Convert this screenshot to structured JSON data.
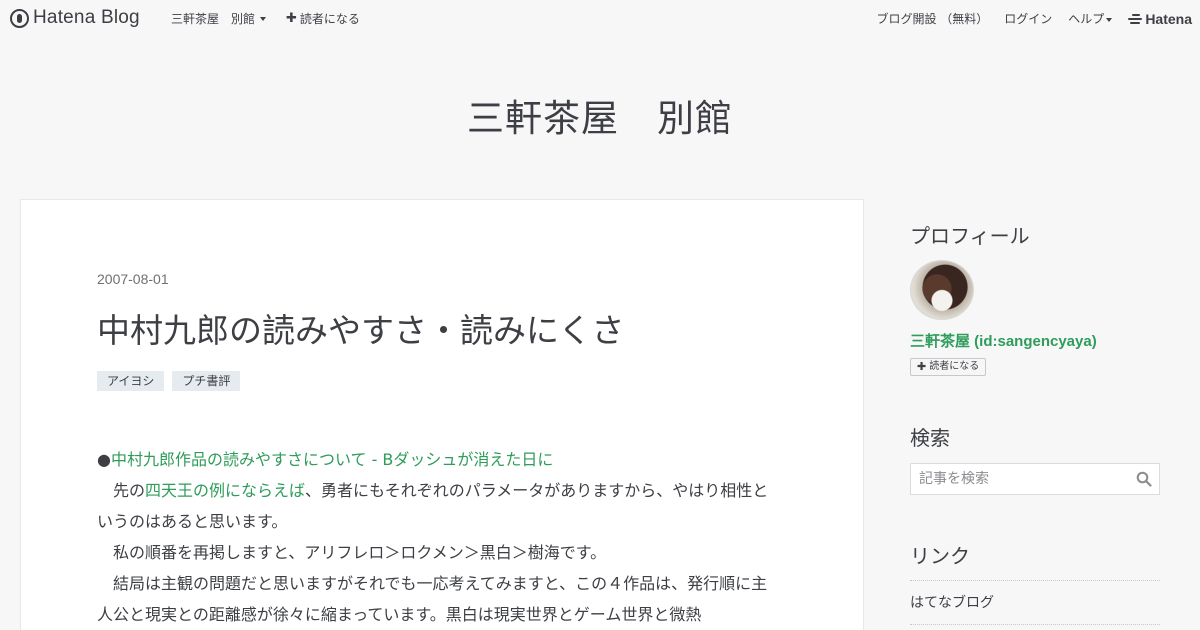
{
  "global_header": {
    "brand": "Hatena Blog",
    "blog_menu": "三軒茶屋　別館",
    "follow": "読者になる",
    "signup": "ブログ開設 （無料）",
    "login": "ログイン",
    "help": "ヘルプ",
    "hatena": "Hatena"
  },
  "blog": {
    "title": "三軒茶屋　別館"
  },
  "entry": {
    "date": "2007-08-01",
    "title": "中村九郎の読みやすさ・読みにくさ",
    "categories": [
      "アイヨシ",
      "プチ書評"
    ],
    "p1_bullet": "●",
    "p1_link": "中村九郎作品の読みやすさについて - Bダッシュが消えた日に",
    "p2_pre": "先の",
    "p2_link": "四天王の例にならえば",
    "p2_post": "、勇者にもそれぞれのパラメータがありますから、やはり相性というのはあると思います。",
    "p3": "私の順番を再掲しますと、アリフレロ＞ロクメン＞黒白＞樹海です。",
    "p4": "結局は主観の問題だと思いますがそれでも一応考えてみますと、この４作品は、発行順に主人公と現実との距離感が徐々に縮まっています。黒白は現実世界とゲーム世界と微熱"
  },
  "sidebar": {
    "profile_heading": "プロフィール",
    "profile_name": "三軒茶屋 (id:sangencyaya)",
    "profile_follow": "読者になる",
    "search_heading": "検索",
    "search_placeholder": "記事を検索",
    "links_heading": "リンク",
    "links": [
      "はてなブログ"
    ]
  },
  "colors": {
    "accent_link": "#2e9c5a",
    "category_bg": "#e6ebef",
    "page_bg": "#f7f7f8"
  },
  "icons": {
    "logo": "hatena-blog-logo-icon",
    "search": "search-icon",
    "plus": "plus-icon"
  }
}
